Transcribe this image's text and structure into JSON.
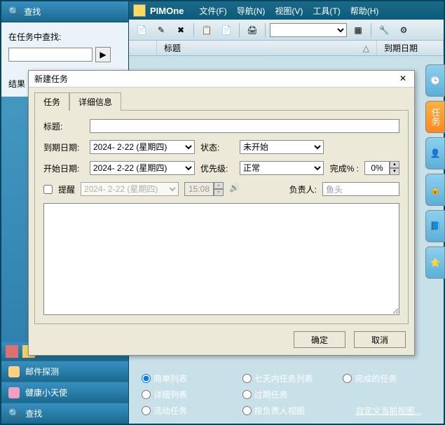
{
  "app": {
    "title": "PIMOne",
    "menus": [
      "文件(F)",
      "导航(N)",
      "视图(V)",
      "工具(T)",
      "帮助(H)"
    ]
  },
  "sidebar": {
    "find_title": "查找",
    "find_label": "在任务中查找:",
    "results_label": "结果",
    "bottom": [
      {
        "label": "邮件探测"
      },
      {
        "label": "健康小天使"
      },
      {
        "label": "查找"
      }
    ]
  },
  "columns": {
    "title": "标题",
    "due": "到期日期"
  },
  "vtab_active": "任务",
  "dialog": {
    "title": "新建任务",
    "tabs": [
      "任务",
      "详细信息"
    ],
    "labels": {
      "title": "标题:",
      "due": "到期日期:",
      "status": "状态:",
      "start": "开始日期:",
      "priority": "优先级:",
      "percent": "完成% :",
      "remind": "提醒",
      "owner": "负责人:"
    },
    "values": {
      "title_input": "",
      "due_date": "2024- 2-22 (星期四)",
      "start_date": "2024- 2-22 (星期四)",
      "status": "未开始",
      "priority": "正常",
      "percent": "0%",
      "remind_date": "2024- 2-22 (星期四)",
      "remind_time": "15:08",
      "owner": "鱼头"
    },
    "buttons": {
      "ok": "确定",
      "cancel": "取消"
    }
  },
  "radios": {
    "r1": "简单列表",
    "r2": "七天内任务列表",
    "r3": "完成的任务",
    "r4": "详细列表",
    "r5": "过期任务",
    "r6": "活动任务",
    "r7": "按负责人视图",
    "link": "自定义当前视图..."
  }
}
